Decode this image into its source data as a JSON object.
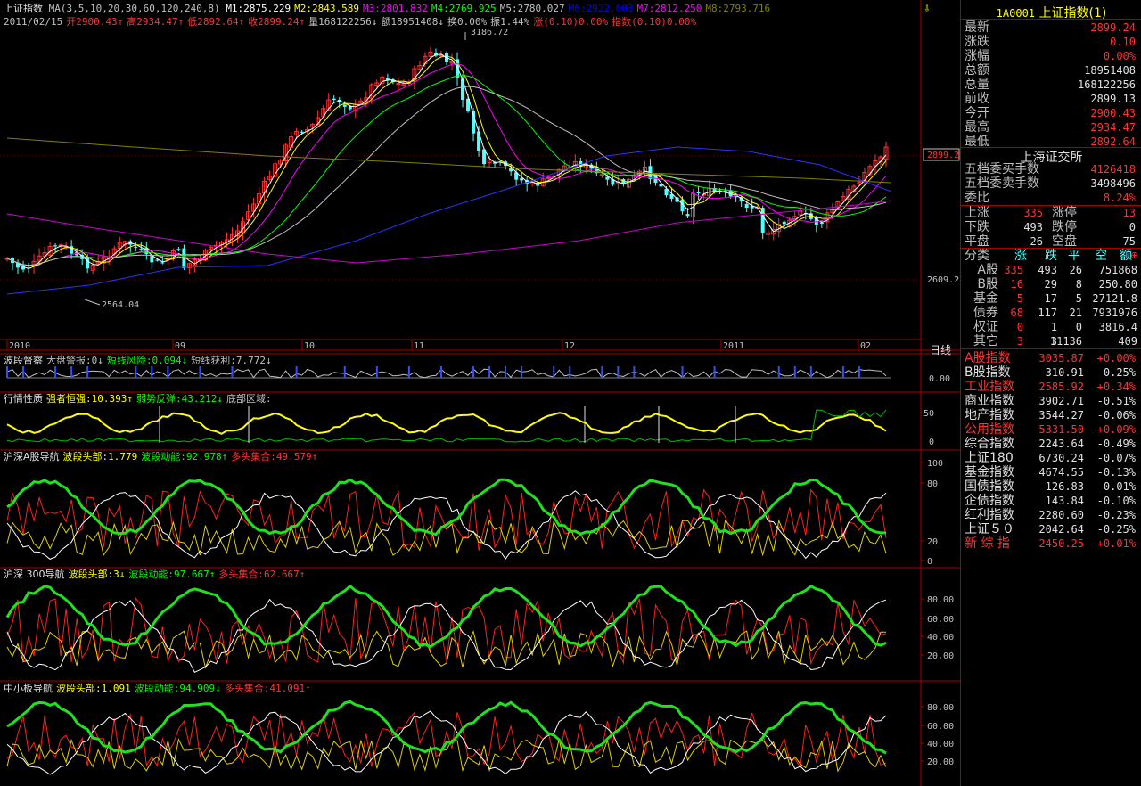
{
  "main": {
    "title": "上证指数",
    "ma_params": "MA(3,5,10,20,30,60,120,240,8)",
    "ma_values": [
      {
        "label": "M1:2875.229",
        "color": "#ffffff"
      },
      {
        "label": "M2:2843.589",
        "color": "#ffff00"
      },
      {
        "label": "M3:2801.832",
        "color": "#ff00ff"
      },
      {
        "label": "M4:2769.925",
        "color": "#00ff00"
      },
      {
        "label": "M5:2780.027",
        "color": "#c0c0c0"
      },
      {
        "label": "M6:2922.003",
        "color": "#0000ff"
      },
      {
        "label": "M7:2812.250",
        "color": "#ff00ff"
      },
      {
        "label": "M8:2793.716",
        "color": "#808000"
      }
    ],
    "quote_line": [
      {
        "t": "2011/02/15",
        "c": "#c0c0c0"
      },
      {
        "t": "开2900.43↑",
        "c": "#ff3232"
      },
      {
        "t": "高2934.47↑",
        "c": "#ff3232"
      },
      {
        "t": "低2892.64↑",
        "c": "#ff3232"
      },
      {
        "t": "收2899.24↑",
        "c": "#ff3232"
      },
      {
        "t": "量168122256↓",
        "c": "#c0c0c0"
      },
      {
        "t": "额18951408↓",
        "c": "#c0c0c0"
      },
      {
        "t": "换0.00%",
        "c": "#c0c0c0"
      },
      {
        "t": "振1.44%",
        "c": "#c0c0c0"
      },
      {
        "t": "涨(0.10)0.00%",
        "c": "#ff3232"
      },
      {
        "t": "指数(0.10)0.00%",
        "c": "#ff3232"
      }
    ],
    "peak_label": "3186.72",
    "low_label": "2564.04",
    "price_tag": "2899.2",
    "axis_label": "2609.2",
    "period_label": "日线",
    "x_labels": [
      "2010",
      "09",
      "10",
      "11",
      "12",
      "2011",
      "02"
    ]
  },
  "panels": [
    {
      "name": "波段督察",
      "items": [
        {
          "t": "大盘警报:0↓",
          "c": "#c0c0c0"
        },
        {
          "t": "短线风险:0.094↓",
          "c": "#00ff00"
        },
        {
          "t": "短线获利:7.772↓",
          "c": "#c0c0c0"
        }
      ],
      "axis": [
        "0.00"
      ]
    },
    {
      "name": "行情性质",
      "items": [
        {
          "t": "强者恒强:10.393↑",
          "c": "#ffff00"
        },
        {
          "t": "弱势反弹:43.212↓",
          "c": "#00ff00"
        },
        {
          "t": "底部区域:",
          "c": "#c0c0c0"
        }
      ],
      "axis": [
        "50",
        "0"
      ]
    },
    {
      "name": "沪深A股导航",
      "items": [
        {
          "t": "波段头部:1.779",
          "c": "#ffff00"
        },
        {
          "t": "波段动能:92.978↑",
          "c": "#00ff00"
        },
        {
          "t": "多头集合:49.579↑",
          "c": "#ff3232"
        }
      ],
      "axis": [
        "100",
        "80",
        "20",
        "0"
      ]
    },
    {
      "name": "沪深 300导航",
      "items": [
        {
          "t": "波段头部:3↓",
          "c": "#ffff00"
        },
        {
          "t": "波段动能:97.667↑",
          "c": "#00ff00"
        },
        {
          "t": "多头集合:62.667↑",
          "c": "#ff3232"
        }
      ],
      "axis": [
        "80.00",
        "60.00",
        "40.00",
        "20.00"
      ]
    },
    {
      "name": "中小板导航",
      "items": [
        {
          "t": "波段头部:1.091",
          "c": "#ffff00"
        },
        {
          "t": "波段动能:94.909↓",
          "c": "#00ff00"
        },
        {
          "t": "多头集合:41.091↑",
          "c": "#ff3232"
        }
      ],
      "axis": [
        "80.00",
        "60.00",
        "40.00",
        "20.00"
      ]
    }
  ],
  "right": {
    "code": "1A0001",
    "name": "上证指数(1)",
    "quote": [
      {
        "l": "最新",
        "v": "2899.24",
        "c": "#ff3232"
      },
      {
        "l": "涨跌",
        "v": "0.10",
        "c": "#ff3232"
      },
      {
        "l": "涨幅",
        "v": "0.00%",
        "c": "#ff3232"
      },
      {
        "l": "总额",
        "v": "18951408",
        "c": "#e0e0e0"
      },
      {
        "l": "总量",
        "v": "168122256",
        "c": "#e0e0e0"
      },
      {
        "l": "前收",
        "v": "2899.13",
        "c": "#e0e0e0"
      },
      {
        "l": "今开",
        "v": "2900.43",
        "c": "#ff3232"
      },
      {
        "l": "最高",
        "v": "2934.47",
        "c": "#ff3232"
      },
      {
        "l": "最低",
        "v": "2892.64",
        "c": "#ff3232"
      }
    ],
    "exchange": "上海证交所",
    "orders": [
      {
        "l": "五档委买手数",
        "v": "4126418",
        "c": "#ff3232"
      },
      {
        "l": "五档委卖手数",
        "v": "3498496",
        "c": "#e0e0e0"
      },
      {
        "l": "委比",
        "v": "8.24%",
        "c": "#ff3232"
      }
    ],
    "breadth": [
      {
        "l1": "上涨",
        "v1": "335",
        "c1": "#ff3232",
        "l2": "涨停",
        "v2": "13",
        "c2": "#ff3232"
      },
      {
        "l1": "下跌",
        "v1": "493",
        "c1": "#e0e0e0",
        "l2": "跌停",
        "v2": "0",
        "c2": "#e0e0e0"
      },
      {
        "l1": "平盘",
        "v1": "26",
        "c1": "#e0e0e0",
        "l2": "空盘",
        "v2": "75",
        "c2": "#e0e0e0"
      }
    ],
    "cat_headers": [
      "分类",
      "涨",
      "跌",
      "平",
      "空",
      "额"
    ],
    "cats": [
      {
        "n": "A股",
        "u": "335",
        "d": "493",
        "f": "26",
        "a": "751868"
      },
      {
        "n": "B股",
        "u": "16",
        "d": "29",
        "f": "8",
        "a": "250.80"
      },
      {
        "n": "基金",
        "u": "5",
        "d": "17",
        "f": "5",
        "a": "27121.8"
      },
      {
        "n": "债券",
        "u": "68",
        "d": "117",
        "f": "21",
        "a": "7931976"
      },
      {
        "n": "权证",
        "u": "0",
        "d": "1",
        "f": "0",
        "a": "3816.4"
      },
      {
        "n": "其它",
        "u": "3",
        "d": "3",
        "f": "11136",
        "a": "409"
      }
    ],
    "indices": [
      {
        "n": "A股指数",
        "v": "3035.87",
        "p": "+0.00%",
        "c": "#ff3232"
      },
      {
        "n": "B股指数",
        "v": "310.91",
        "p": "-0.25%",
        "c": "#e0e0e0"
      },
      {
        "n": "工业指数",
        "v": "2585.92",
        "p": "+0.34%",
        "c": "#ff3232"
      },
      {
        "n": "商业指数",
        "v": "3902.71",
        "p": "-0.51%",
        "c": "#e0e0e0"
      },
      {
        "n": "地产指数",
        "v": "3544.27",
        "p": "-0.06%",
        "c": "#e0e0e0"
      },
      {
        "n": "公用指数",
        "v": "5331.50",
        "p": "+0.09%",
        "c": "#ff3232"
      },
      {
        "n": "综合指数",
        "v": "2243.64",
        "p": "-0.49%",
        "c": "#e0e0e0"
      },
      {
        "n": "上证180",
        "v": "6730.24",
        "p": "-0.07%",
        "c": "#e0e0e0"
      },
      {
        "n": "基金指数",
        "v": "4674.55",
        "p": "-0.13%",
        "c": "#e0e0e0"
      },
      {
        "n": "国债指数",
        "v": "126.83",
        "p": "-0.01%",
        "c": "#e0e0e0"
      },
      {
        "n": "企债指数",
        "v": "143.84",
        "p": "-0.10%",
        "c": "#e0e0e0"
      },
      {
        "n": "红利指数",
        "v": "2280.60",
        "p": "-0.23%",
        "c": "#e0e0e0"
      },
      {
        "n": "上证５０",
        "v": "2042.64",
        "p": "-0.25%",
        "c": "#e0e0e0"
      },
      {
        "n": "新 综 指",
        "v": "2450.25",
        "p": "+0.01%",
        "c": "#ff3232"
      }
    ]
  }
}
